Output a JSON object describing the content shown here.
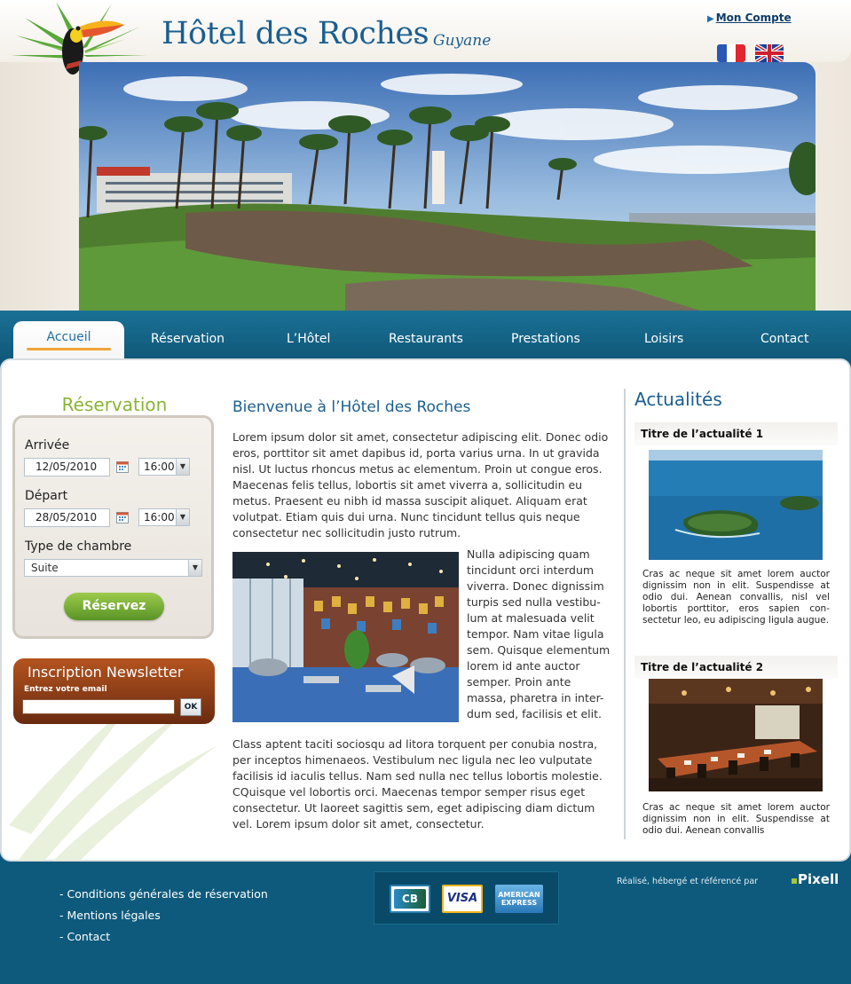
{
  "header": {
    "title": "Hôtel des Roches",
    "separator": "-",
    "subtitle": "Guyane",
    "account_link": "Mon Compte",
    "account_icon": "arrow-right-icon"
  },
  "languages": [
    "fr-flag-icon",
    "uk-flag-icon"
  ],
  "nav": {
    "items": [
      "Accueil",
      "Réservation",
      "L’Hôtel",
      "Restaurants",
      "Prestations",
      "Loisirs",
      "Contact"
    ],
    "active_index": 0
  },
  "reservation": {
    "title": "Réservation",
    "arrival_label": "Arrivée",
    "arrival_date": "12/05/2010",
    "arrival_time": "16:00",
    "departure_label": "Départ",
    "departure_date": "28/05/2010",
    "departure_time": "16:00",
    "room_label": "Type de chambre",
    "room_value": "Suite",
    "submit": "Réservez"
  },
  "newsletter": {
    "title": "Inscription Newsletter",
    "email_label": "Entrez votre email",
    "email_value": "",
    "ok": "OK"
  },
  "main": {
    "title": "Bienvenue à l’Hôtel des Roches",
    "paragraph1": "Lorem ipsum dolor sit amet, consectetur adipiscing elit. Donec odio eros, porttitor sit amet dapibus id, porta varius urna. In ut gravida nisl. Ut luctus rhoncus metus ac elementum. Proin ut congue eros. Maecenas felis tellus, lobortis sit amet viverra a, sollicitudin eu metus. Praesent eu nibh id massa suscipit aliquet. Aliquam erat volutpat. Etiam quis dui urna. Nunc tincidunt tellus quis neque consectetur nec sollicitudin justo rutrum.",
    "paragraph2": "Nulla adipiscing quam tincidunt orci interdum viverra. Donec dignissim turpis sed nulla vestibu-lum at malesuada velit tempor. Nam vitae ligula sem. Quisque elementum lorem id ante auctor semper. Proin ante massa, pharetra in inter-dum sed, facilisis et elit.",
    "paragraph3": "Class aptent taciti sociosqu ad litora torquent per conubia nostra, per inceptos himenaeos. Vestibulum nec ligula nec leo vulputate facilisis id iaculis tellus. Nam sed nulla nec tellus lobortis molestie. CQuisque vel lobortis orci. Maecenas tempor semper risus eget consectetur. Ut laoreet sagittis sem, eget adipiscing diam dictum vel. Lorem ipsum dolor sit amet, consectetur."
  },
  "news": {
    "title": "Actualités",
    "items": [
      {
        "title": "Titre de l’actualité 1",
        "text": "Cras ac neque sit amet lorem auctor dignissim non in elit. Suspendisse at odio dui. Aenean convallis, nisl vel lobortis porttitor, eros sapien con-sectetur leo, eu adipiscing ligula augue."
      },
      {
        "title": "Titre de l’actualité 2",
        "text": "Cras ac neque sit amet lorem auctor dignissim non in elit. Suspendisse at odio dui. Aenean convallis"
      }
    ]
  },
  "footer": {
    "links": [
      "- Conditions générales de réservation",
      "- Mentions légales",
      "- Contact"
    ],
    "cards": {
      "cb": "CB",
      "visa": "VISA",
      "amex_line1": "AMERICAN",
      "amex_line2": "EXPRESS"
    },
    "credit": "Réalisé, hébergé et référencé par",
    "credit_brand": "Pixell"
  },
  "colors": {
    "brand_blue": "#1b5e8f",
    "reservation_green": "#88b536",
    "newsletter_brown": "#8a3a14",
    "footer_blue": "#0d5a7c"
  }
}
